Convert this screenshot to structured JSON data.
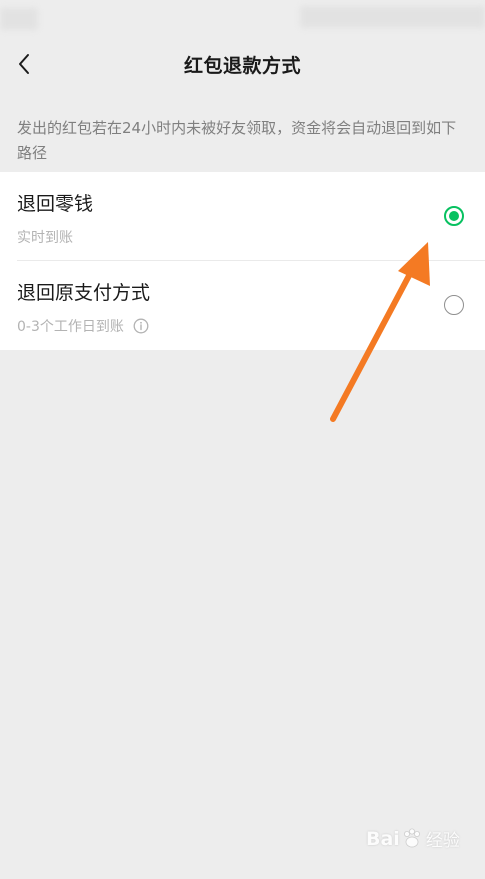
{
  "header": {
    "title": "红包退款方式"
  },
  "description": "发出的红包若在24小时内未被好友领取，资金将会自动退回到如下路径",
  "options": [
    {
      "title": "退回零钱",
      "subtitle": "实时到账",
      "selected": true
    },
    {
      "title": "退回原支付方式",
      "subtitle": "0-3个工作日到账",
      "selected": false
    }
  ],
  "watermark": {
    "brand": "Bai",
    "suffix": "经验"
  },
  "colors": {
    "accent": "#07c160",
    "background": "#ededed",
    "arrow": "#f47a23"
  },
  "icons": {
    "back": "chevron-left-icon",
    "info": "info-icon",
    "annotation": "arrow-icon"
  }
}
